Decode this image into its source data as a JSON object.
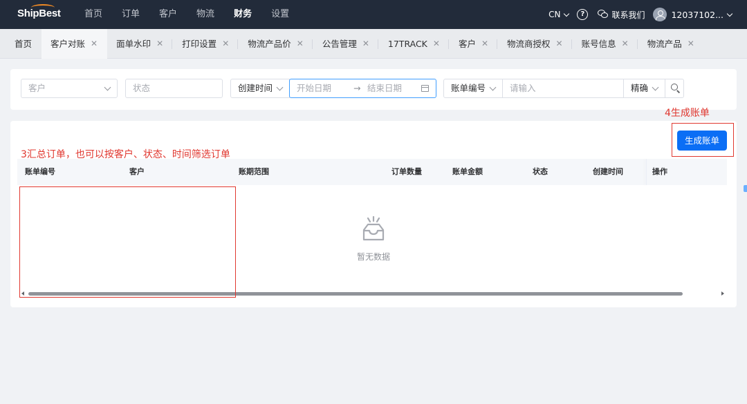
{
  "brand": {
    "logo_text": "ShipBest",
    "accent": "#f08a24"
  },
  "nav": {
    "items": [
      {
        "label": "首页",
        "active": false
      },
      {
        "label": "订单",
        "active": false
      },
      {
        "label": "客户",
        "active": false
      },
      {
        "label": "物流",
        "active": false
      },
      {
        "label": "财务",
        "active": true
      },
      {
        "label": "设置",
        "active": false
      }
    ],
    "lang": "CN",
    "contact_label": "联系我们",
    "username": "12037102..."
  },
  "tabs": [
    {
      "label": "首页",
      "closable": false
    },
    {
      "label": "客户对账",
      "closable": true,
      "active": true
    },
    {
      "label": "面单水印",
      "closable": true
    },
    {
      "label": "打印设置",
      "closable": true
    },
    {
      "label": "物流产品价",
      "closable": true
    },
    {
      "label": "公告管理",
      "closable": true
    },
    {
      "label": "17TRACK",
      "closable": true
    },
    {
      "label": "客户",
      "closable": true
    },
    {
      "label": "物流商授权",
      "closable": true
    },
    {
      "label": "账号信息",
      "closable": true
    },
    {
      "label": "物流产品",
      "closable": true
    }
  ],
  "filters": {
    "customer_placeholder": "客户",
    "status_placeholder": "状态",
    "time_type": "创建时间",
    "start_placeholder": "开始日期",
    "end_placeholder": "结束日期",
    "range_sep": "→",
    "field_type": "账单编号",
    "keyword_placeholder": "请输入",
    "match_mode": "精确"
  },
  "table": {
    "generate_label": "生成账单",
    "columns": [
      "账单编号",
      "客户",
      "账期范围",
      "订单数量",
      "账单金额",
      "状态",
      "创建时间",
      "操作"
    ],
    "empty_text": "暂无数据"
  },
  "annotations": {
    "step3": "3汇总订单，也可以按客户、状态、时间筛选订单",
    "step4": "4生成账单",
    "color": "#e0372f"
  },
  "colors": {
    "primary": "#0b6ef5",
    "topbar": "#222b3a"
  }
}
